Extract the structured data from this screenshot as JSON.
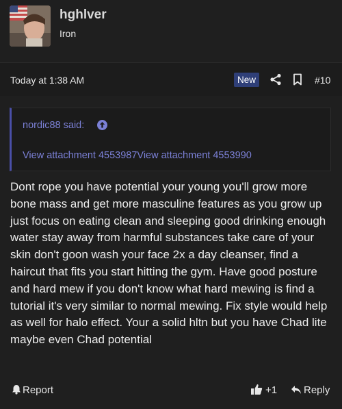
{
  "post": {
    "username": "hghlver",
    "rank": "Iron",
    "timestamp": "Today at 1:38 AM",
    "badge": "New",
    "post_number": "#10",
    "quote": {
      "author_label": "nordic88 said:",
      "attachments_text": "View attachment 4553987View attachment 4553990"
    },
    "body": "Dont rope you have potential your young you'll grow more bone mass and get more masculine features as you grow up just focus on eating clean and sleeping good drinking enough water stay away from harmful substances take care of your skin don't goon wash your face 2x a day cleanser, find a haircut that fits you start hitting the gym. Have good posture and hard mew if you don't know what hard mewing is find a tutorial it's very similar to normal mewing. Fix style would help as well for halo effect. Your a solid hltn but you have Chad lite maybe even Chad potential",
    "actions": {
      "report_label": "Report",
      "like_count": "+1",
      "reply_label": "Reply"
    }
  },
  "icons": {
    "share": "share-icon",
    "bookmark": "bookmark-icon",
    "quote_link": "arrow-up-circle-icon",
    "report": "bell-icon",
    "like": "thumbs-up-icon",
    "reply": "reply-arrow-icon"
  },
  "colors": {
    "background": "#1f1f1f",
    "link": "#7b80d6",
    "badge": "#2f3f78",
    "quote_border": "#4a4fa8"
  }
}
